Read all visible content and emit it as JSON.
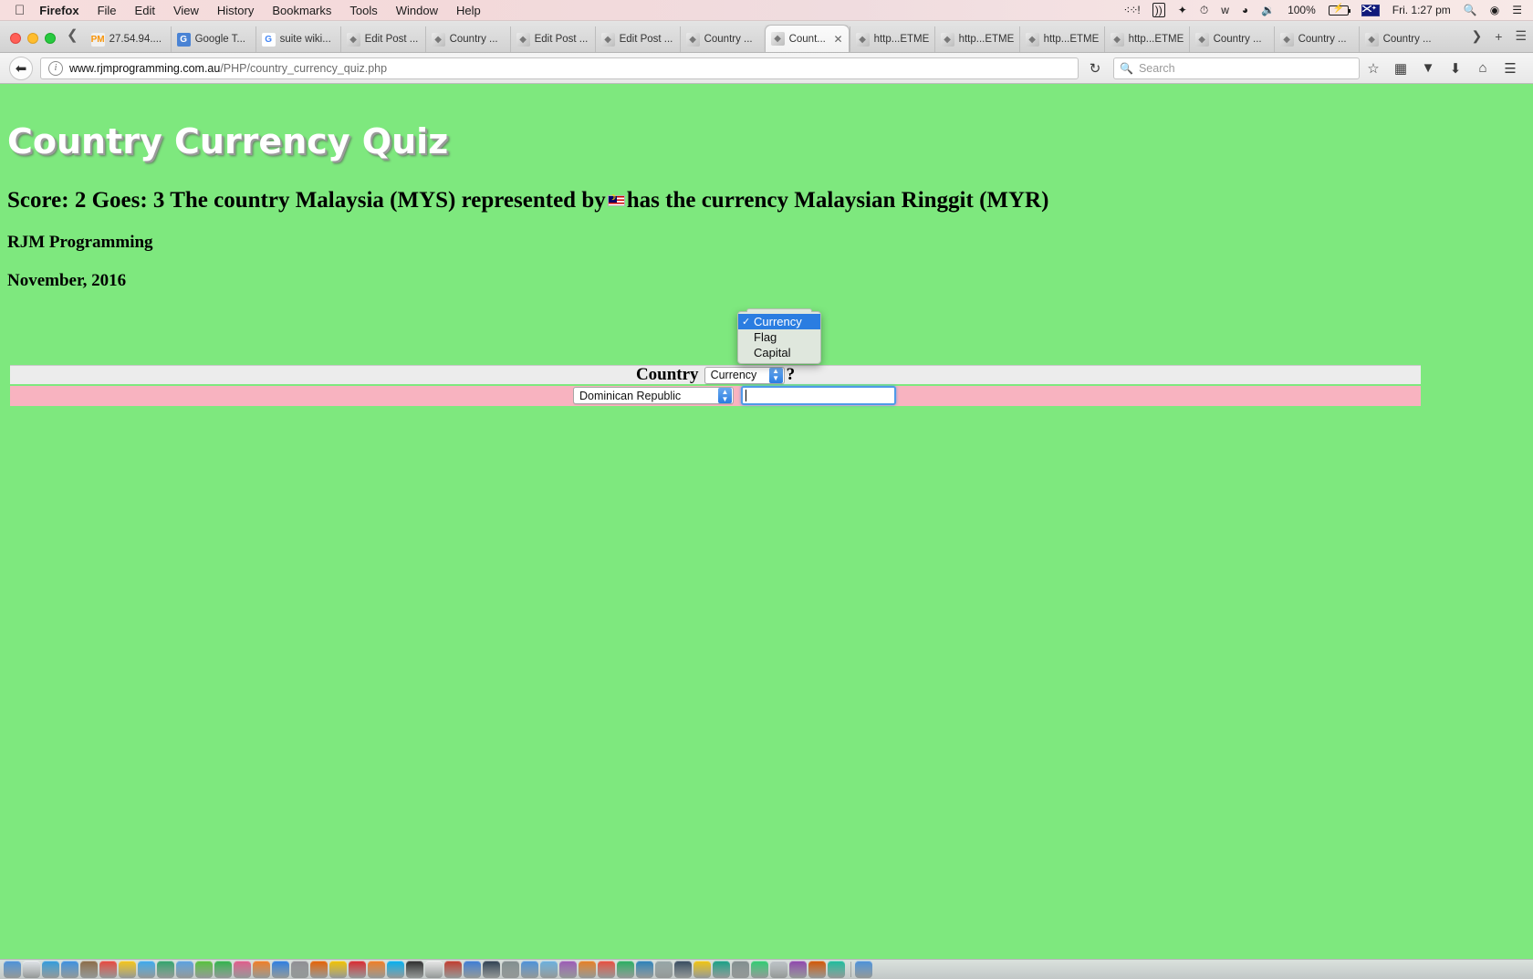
{
  "menubar": {
    "apple_icon": "apple-icon",
    "items": [
      "Firefox",
      "File",
      "Edit",
      "View",
      "History",
      "Bookmarks",
      "Tools",
      "Window",
      "Help"
    ],
    "status": {
      "dots_icon": "dots-icon",
      "airplay_icon": "airplay-icon",
      "dropbox_icon": "dropbox-icon",
      "timemachine_icon": "time-machine-icon",
      "bluetooth_icon": "bluetooth-icon",
      "wifi_icon": "wifi-icon",
      "volume_icon": "volume-icon",
      "battery_percent": "100%",
      "battery_icon": "battery-charging-icon",
      "flag_icon": "australia-flag-icon",
      "clock": "Fri. 1:27 pm",
      "search_icon": "spotlight-search-icon",
      "siri_icon": "siri-icon",
      "menu_icon": "notification-center-icon"
    }
  },
  "window": {
    "traffic_lights": [
      "close",
      "minimize",
      "zoom"
    ],
    "tab_scroll_left_icon": "chevron-left-icon",
    "tab_scroll_right_icon": "chevron-right-icon",
    "new_tab_icon": "plus-icon",
    "tab_list_icon": "hamburger-icon",
    "tabs": [
      {
        "label": "27.54.94....",
        "favicon": "phpmyadmin-icon",
        "active": false
      },
      {
        "label": "Google T...",
        "favicon": "google-translate-icon",
        "active": false
      },
      {
        "label": "suite wiki...",
        "favicon": "google-icon",
        "active": false
      },
      {
        "label": "Edit Post ...",
        "favicon": "document-icon",
        "active": false
      },
      {
        "label": "Country ...",
        "favicon": "document-icon",
        "active": false
      },
      {
        "label": "Edit Post ...",
        "favicon": "document-icon",
        "active": false
      },
      {
        "label": "Edit Post ...",
        "favicon": "document-icon",
        "active": false
      },
      {
        "label": "Country ...",
        "favicon": "document-icon",
        "active": false
      },
      {
        "label": "Count...",
        "favicon": "document-icon",
        "active": true,
        "close_icon": "close-icon"
      },
      {
        "label": "http...ETME",
        "favicon": "document-icon",
        "active": false
      },
      {
        "label": "http...ETME",
        "favicon": "document-icon",
        "active": false
      },
      {
        "label": "http...ETME",
        "favicon": "document-icon",
        "active": false
      },
      {
        "label": "http...ETME",
        "favicon": "document-icon",
        "active": false
      },
      {
        "label": "Country ...",
        "favicon": "document-icon",
        "active": false
      },
      {
        "label": "Country ...",
        "favicon": "document-icon",
        "active": false
      },
      {
        "label": "Country ...",
        "favicon": "document-icon",
        "active": false
      }
    ]
  },
  "navbar": {
    "back_icon": "back-arrow-icon",
    "identity_icon": "info-icon",
    "url_host": "www.rjmprogramming.com.au",
    "url_path": "/PHP/country_currency_quiz.php",
    "reload_icon": "reload-icon",
    "search_icon": "search-icon",
    "search_placeholder": "Search",
    "bookmark_icon": "star-icon",
    "reader_icon": "reader-view-icon",
    "pocket_icon": "pocket-icon",
    "download_icon": "download-icon",
    "home_icon": "home-icon",
    "menu_icon": "hamburger-menu-icon"
  },
  "page": {
    "title": "Country Currency Quiz",
    "score_prefix": "Score: 2 Goes: 3 The country Malaysia (MYS) represented by",
    "flag_icon": "malaysia-flag-icon",
    "score_suffix": "has the currency Malaysian Ringgit (MYR)",
    "author": "RJM Programming",
    "date": "November, 2016",
    "background_color": "#7ee87e",
    "question_label": "Country",
    "question_mark": "?",
    "type_select_value": "Currency",
    "country_select_value": "Dominican Republic",
    "answer_input_value": "",
    "row1_color": "#ececec",
    "row2_color": "#f8b3c0",
    "stepper_color": "#2a7de1",
    "dropdown": {
      "check_icon": "checkmark-icon",
      "options": [
        {
          "label": "Currency",
          "selected": true
        },
        {
          "label": "Flag",
          "selected": false
        },
        {
          "label": "Capital",
          "selected": false
        }
      ]
    }
  },
  "dock": {
    "icons": [
      "finder-icon",
      "launchpad-icon",
      "safari-icon",
      "mail-icon",
      "contacts-icon",
      "calendar-icon",
      "notes-icon",
      "reminders-icon",
      "maps-icon",
      "photos-icon",
      "messages-icon",
      "facetime-icon",
      "itunes-icon",
      "ibooks-icon",
      "appstore-icon",
      "preferences-icon",
      "firefox-icon",
      "chrome-icon",
      "opera-icon",
      "vlc-icon",
      "skype-icon",
      "terminal-icon",
      "textedit-icon",
      "filezilla-icon",
      "xcode-icon",
      "dashboard-icon",
      "automator-icon",
      "quicktime-icon",
      "preview-icon",
      "imovie-icon",
      "garageband-icon",
      "pages-icon",
      "numbers-icon",
      "keynote-icon",
      "calculator-icon",
      "dictionary-icon",
      "stickies-icon",
      "chess-icon",
      "timemachine-icon",
      "activitymonitor-icon",
      "console-icon",
      "diskutility-icon",
      "grab-icon",
      "script-editor-icon",
      "trash-icon"
    ]
  }
}
